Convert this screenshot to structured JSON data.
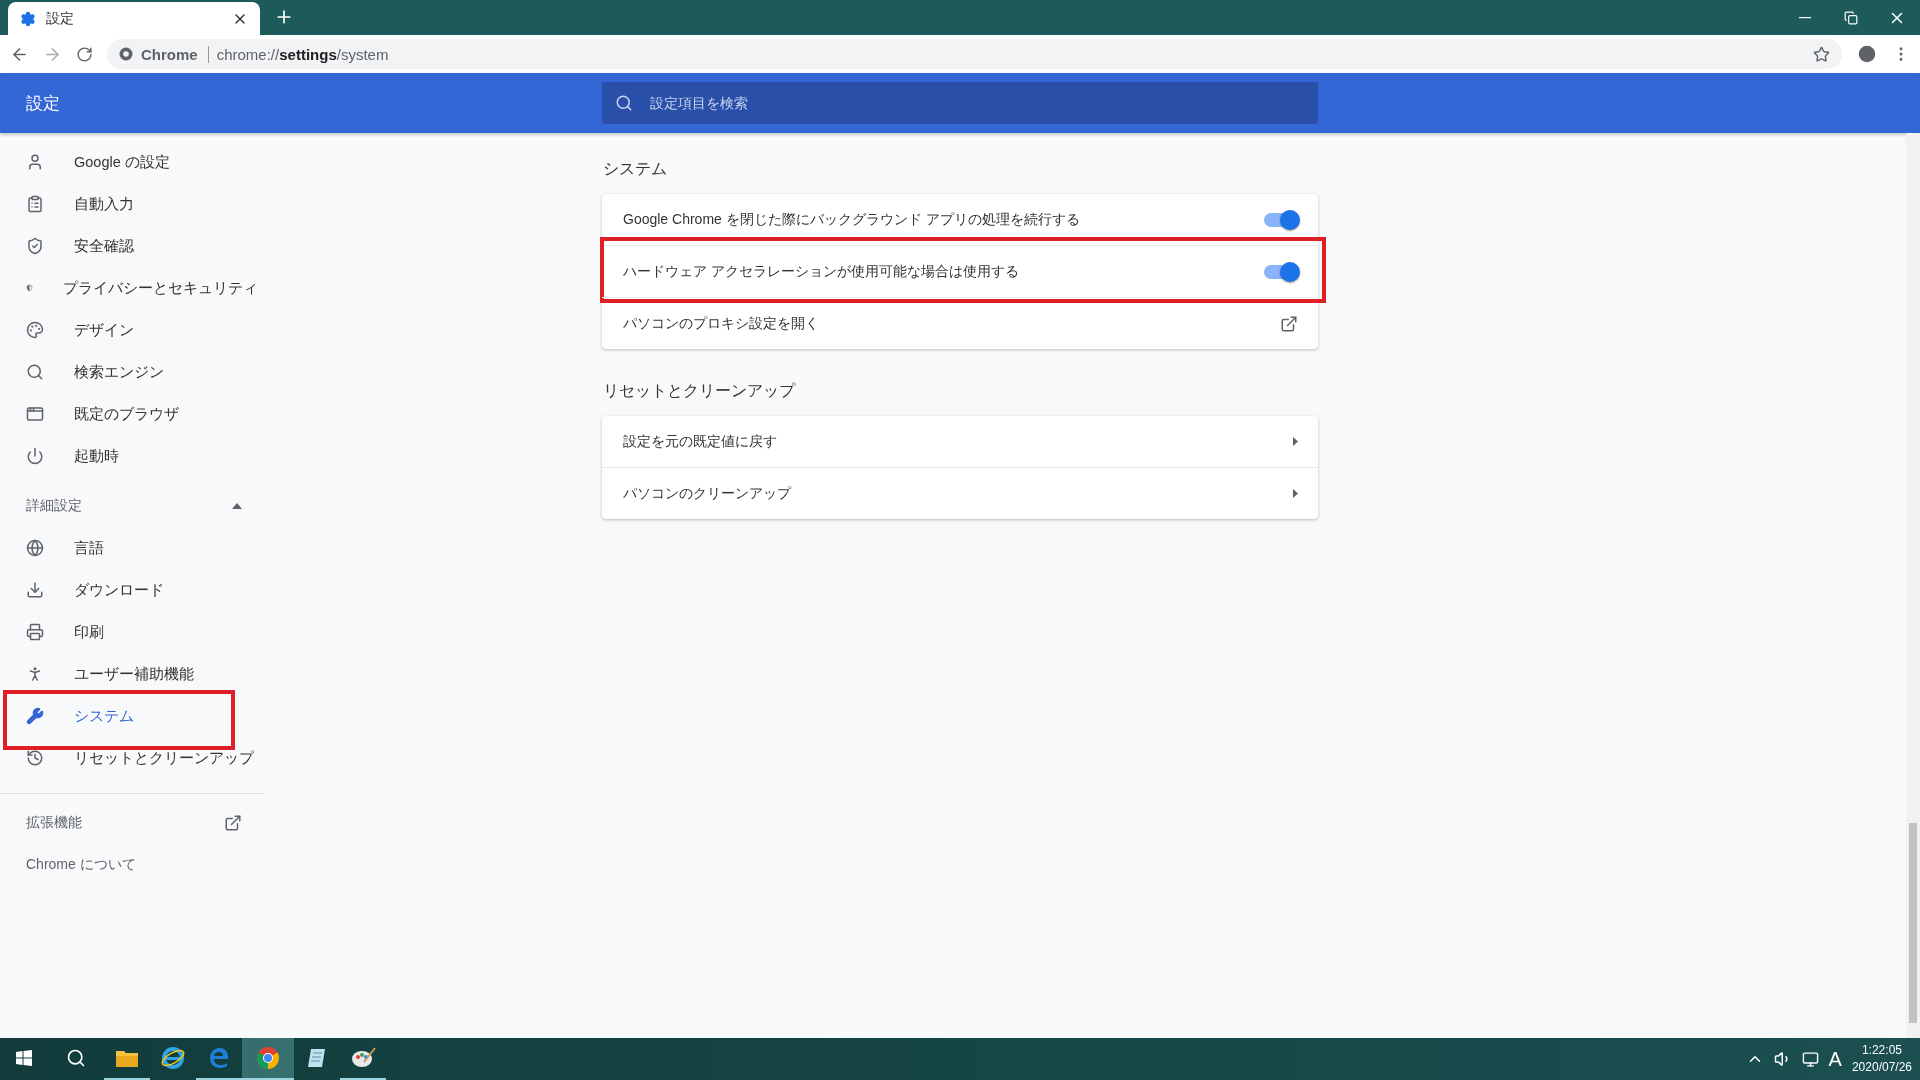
{
  "tab": {
    "title": "設定",
    "selected": true
  },
  "address_bar": {
    "site": "Chrome",
    "url": "chrome://**settings**/system"
  },
  "header": {
    "title": "設定",
    "search": {
      "placeholder": "設定項目を検索"
    }
  },
  "sidebar": {
    "items": [
      {
        "label": "Google の設定",
        "selected": false,
        "highlighted": false
      },
      {
        "label": "自動入力",
        "selected": false,
        "highlighted": false
      },
      {
        "label": "安全確認",
        "selected": false,
        "highlighted": false
      },
      {
        "label": "プライバシーとセキュリティ",
        "selected": false,
        "highlighted": false
      },
      {
        "label": "デザイン",
        "selected": false,
        "highlighted": false
      },
      {
        "label": "検索エンジン",
        "selected": false,
        "highlighted": false
      },
      {
        "label": "既定のブラウザ",
        "selected": false,
        "highlighted": false
      },
      {
        "label": "起動時",
        "selected": false,
        "highlighted": false
      }
    ],
    "advanced": {
      "label": "詳細設定",
      "expanded": true,
      "items": [
        {
          "label": "言語",
          "selected": false,
          "highlighted": false
        },
        {
          "label": "ダウンロード",
          "selected": false,
          "highlighted": false
        },
        {
          "label": "印刷",
          "selected": false,
          "highlighted": false
        },
        {
          "label": "ユーザー補助機能",
          "selected": false,
          "highlighted": false
        },
        {
          "label": "システム",
          "selected": true,
          "highlighted": true
        },
        {
          "label": "リセットとクリーンアップ",
          "selected": false,
          "highlighted": false
        }
      ]
    },
    "extensions": "拡張機能",
    "about": "Chrome について"
  },
  "sections": [
    {
      "title": "システム",
      "rows": [
        {
          "kind": "toggle",
          "label": "Google Chrome を閉じた際にバックグラウンド アプリの処理を続行する",
          "on": true,
          "highlighted": false
        },
        {
          "kind": "toggle",
          "label": "ハードウェア アクセラレーションが使用可能な場合は使用する",
          "on": true,
          "highlighted": true
        },
        {
          "kind": "external",
          "label": "パソコンのプロキシ設定を開く",
          "highlighted": false
        }
      ]
    },
    {
      "title": "リセットとクリーンアップ",
      "rows": [
        {
          "kind": "subpage",
          "label": "設定を元の既定値に戻す",
          "highlighted": false
        },
        {
          "kind": "subpage",
          "label": "パソコンのクリーンアップ",
          "highlighted": false
        }
      ]
    }
  ],
  "taskbar": {
    "apps": [
      {
        "kind": "folder",
        "running": true,
        "selected": false
      },
      {
        "kind": "ie",
        "running": false,
        "selected": false
      },
      {
        "kind": "edge",
        "running": true,
        "selected": false
      },
      {
        "kind": "chrome",
        "running": true,
        "selected": true
      },
      {
        "kind": "notepad",
        "running": false,
        "selected": false
      },
      {
        "kind": "paint",
        "running": true,
        "selected": false
      }
    ],
    "ime": "A",
    "time": "1:22:05",
    "date": "2020/07/26"
  }
}
